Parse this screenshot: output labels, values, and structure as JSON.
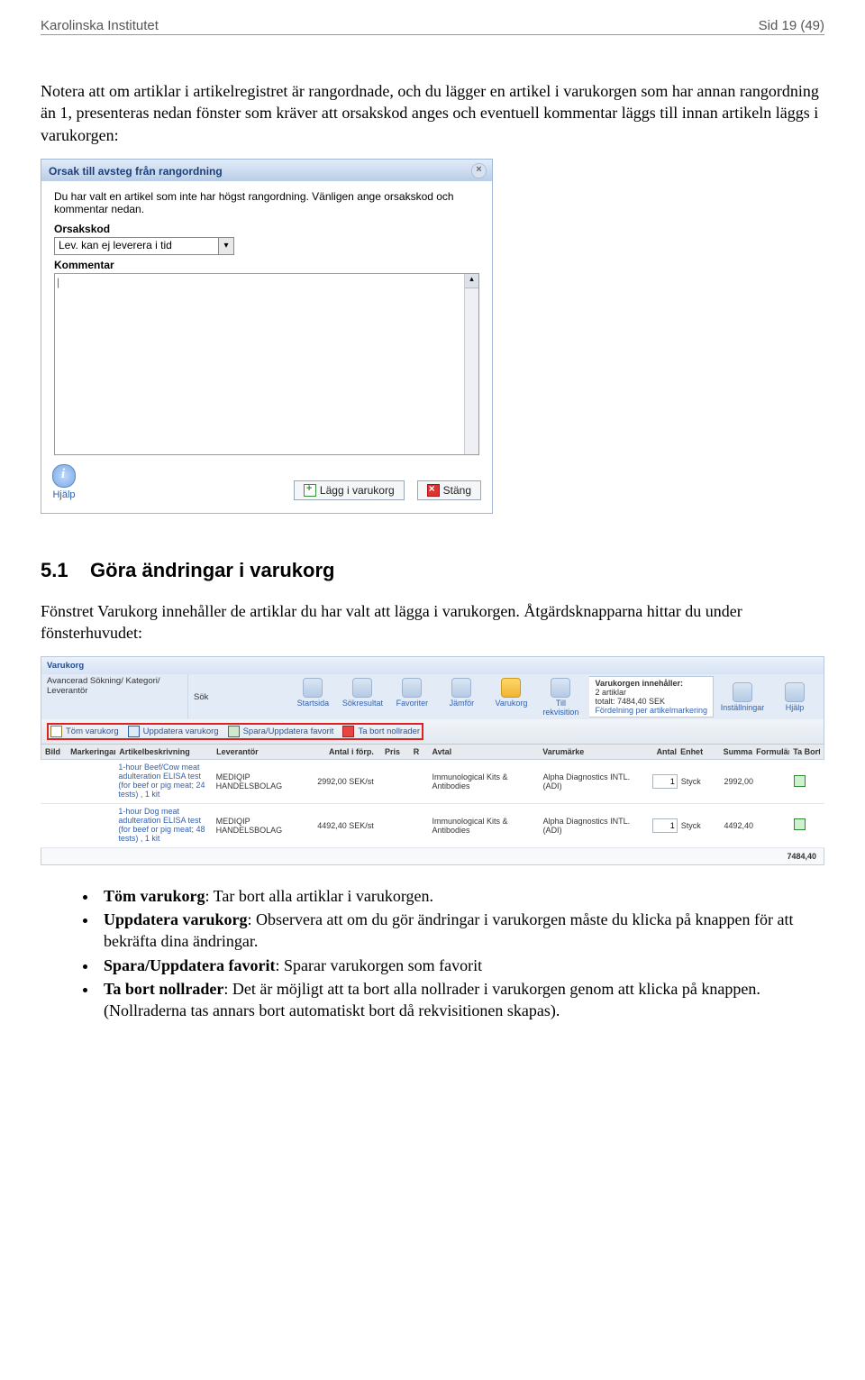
{
  "header": {
    "left": "Karolinska Institutet",
    "right": "Sid 19 (49)"
  },
  "intro": "Notera att om artiklar i artikelregistret är rangordnade, och du lägger en artikel i varukorgen som har annan rangordning än 1, presenteras nedan fönster som kräver att orsakskod anges och eventuell kommentar läggs till innan artikeln läggs i varukorgen:",
  "dialog": {
    "title": "Orsak till avsteg från rangordning",
    "text": "Du har valt en artikel som inte har högst rangordning. Vänligen ange orsakskod och kommentar nedan.",
    "orsakskod_label": "Orsakskod",
    "orsakskod_value": "Lev. kan ej leverera i tid",
    "kommentar_label": "Kommentar",
    "help": "Hjälp",
    "btn_add": "Lägg i varukorg",
    "btn_close": "Stäng"
  },
  "section": {
    "num": "5.1",
    "title": "Göra ändringar i varukorg",
    "para": "Fönstret Varukorg innehåller de artiklar du har valt att lägga i varukorgen. Åtgärdsknapparna hittar du under fönsterhuvudet:"
  },
  "vk": {
    "title": "Varukorg",
    "breadcrumbs": [
      "Avancerad Sökning",
      "Kategori",
      "Leverantör"
    ],
    "sok": "Sök",
    "nav": [
      "Startsida",
      "Sökresultat",
      "Favoriter",
      "Jämför",
      "Varukorg",
      "Till rekvisition",
      "Inställningar",
      "Hjälp"
    ],
    "nav_active_index": 4,
    "info_head": "Varukorgen innehåller:",
    "info_line1": "2 artiklar",
    "info_line2": "totalt: 7484,40 SEK",
    "info_line3": "Fördelning per artikelmarkering",
    "actions": {
      "tom": "Töm varukorg",
      "upp": "Uppdatera varukorg",
      "fav": "Spara/Uppdatera favorit",
      "nol": "Ta bort nollrader"
    },
    "cols": [
      "Bild",
      "Markeringar",
      "Artikelbeskrivning",
      "Leverantör",
      "Antal i förp.",
      "Pris",
      "R",
      "Avtal",
      "Varumärke",
      "Antal",
      "Enhet",
      "Summa",
      "Formulär",
      "Ta Bort"
    ],
    "rows": [
      {
        "art_l1": "1-hour Beef/Cow meat",
        "art_l2": "adulteration ELISA test",
        "art_l3": "(for beef or pig meat; 24",
        "art_l4": "tests) , 1 kit",
        "lev": "MEDIQIP HANDELSBOLAG",
        "af": "2992,00 SEK/st",
        "avtal": "Immunological Kits & Antibodies",
        "vm": "Alpha Diagnostics INTL. (ADI)",
        "antal": "1",
        "enhet": "Styck",
        "summa": "2992,00"
      },
      {
        "art_l1": "1-hour Dog meat",
        "art_l2": "adulteration ELISA test",
        "art_l3": "(for beef or pig meat; 48",
        "art_l4": "tests) , 1 kit",
        "lev": "MEDIQIP HANDELSBOLAG",
        "af": "4492,40 SEK/st",
        "avtal": "Immunological Kits & Antibodies",
        "vm": "Alpha Diagnostics INTL. (ADI)",
        "antal": "1",
        "enhet": "Styck",
        "summa": "4492,40"
      }
    ],
    "total": "7484,40"
  },
  "bullets": {
    "b1a": "Töm varukorg",
    "b1b": ": Tar bort alla artiklar i varukorgen.",
    "b2a": "Uppdatera varukorg",
    "b2b": ": Observera att om du gör ändringar i varukorgen måste du klicka på knappen för att bekräfta dina ändringar.",
    "b3a": "Spara/Uppdatera favorit",
    "b3b": ": Sparar varukorgen som favorit",
    "b4a": "Ta bort nollrader",
    "b4b": ": Det är möjligt att ta bort alla nollrader i varukorgen genom att klicka på knappen. (Nollraderna tas annars bort automatiskt bort då rekvisitionen skapas)."
  }
}
